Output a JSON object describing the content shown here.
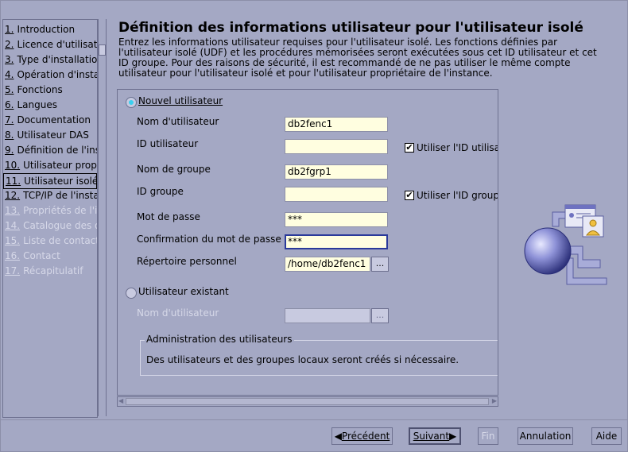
{
  "sidebar": {
    "steps": [
      {
        "num": "1.",
        "label": "Introduction"
      },
      {
        "num": "2.",
        "label": "Licence d'utilisati"
      },
      {
        "num": "3.",
        "label": "Type d'installatio"
      },
      {
        "num": "4.",
        "label": "Opération d'insta"
      },
      {
        "num": "5.",
        "label": "Fonctions"
      },
      {
        "num": "6.",
        "label": "Langues"
      },
      {
        "num": "7.",
        "label": "Documentation"
      },
      {
        "num": "8.",
        "label": "Utilisateur DAS"
      },
      {
        "num": "9.",
        "label": "Définition de l'ins"
      },
      {
        "num": "10.",
        "label": "Utilisateur prop"
      },
      {
        "num": "11.",
        "label": "Utilisateur isolé"
      },
      {
        "num": "12.",
        "label": "TCP/IP de l'insta"
      },
      {
        "num": "13.",
        "label": "Propriétés de l'i"
      },
      {
        "num": "14.",
        "label": "Catalogue des o"
      },
      {
        "num": "15.",
        "label": "Liste de contacts"
      },
      {
        "num": "16.",
        "label": "Contact"
      },
      {
        "num": "17.",
        "label": "Récapitulatif"
      }
    ]
  },
  "main": {
    "title": "Définition des informations utilisateur pour l'utilisateur isolé",
    "description": "Entrez les informations utilisateur requises pour l'utilisateur isolé.  Les fonctions définies par l'utilisateur isolé (UDF) et les procédures mémorisées seront exécutées sous cet ID utilisateur et cet ID groupe.  Pour des raisons de sécurité, il est recommandé de ne pas utiliser le même compte utilisateur pour l'utilisateur isolé et pour l'utilisateur propriétaire de l'instance."
  },
  "form": {
    "new_user_label": "Nouvel utilisateur",
    "username_label": "Nom d'utilisateur",
    "username_value": "db2fenc1",
    "userid_label": "ID utilisateur",
    "userid_value": "",
    "use_default_uid_label": "Utiliser l'ID utilisat",
    "group_name_label": "Nom de groupe",
    "group_name_value": "db2fgrp1",
    "group_id_label": "ID groupe",
    "group_id_value": "",
    "use_default_gid_label": "Utiliser l'ID groupe",
    "password_label": "Mot de passe",
    "password_value": "***",
    "confirm_label": "Confirmation du mot de passe",
    "confirm_value": "***",
    "home_label": "Répertoire personnel",
    "home_value": "/home/db2fenc1",
    "browse_label": "...",
    "existing_user_label": "Utilisateur existant",
    "existing_username_label": "Nom d'utilisateur",
    "existing_username_value": "",
    "admin_group_title": "Administration des utilisateurs",
    "admin_group_text": "Des utilisateurs et des groupes locaux seront créés si nécessaire."
  },
  "buttons": {
    "previous": "Précédent",
    "next": "Suivant",
    "finish": "Fin",
    "cancel": "Annulation",
    "help": "Aide"
  },
  "colors": {
    "background": "#a4a8c4",
    "input_background": "#fffee0",
    "disabled_text": "#d6d8e8",
    "radio_accent": "#3ad0f0",
    "globe": "#8f93d8"
  },
  "state": {
    "new_user_selected": true,
    "active_step": 11,
    "first_disabled_step": 13,
    "use_default_uid_checked": true,
    "use_default_gid_checked": true
  }
}
